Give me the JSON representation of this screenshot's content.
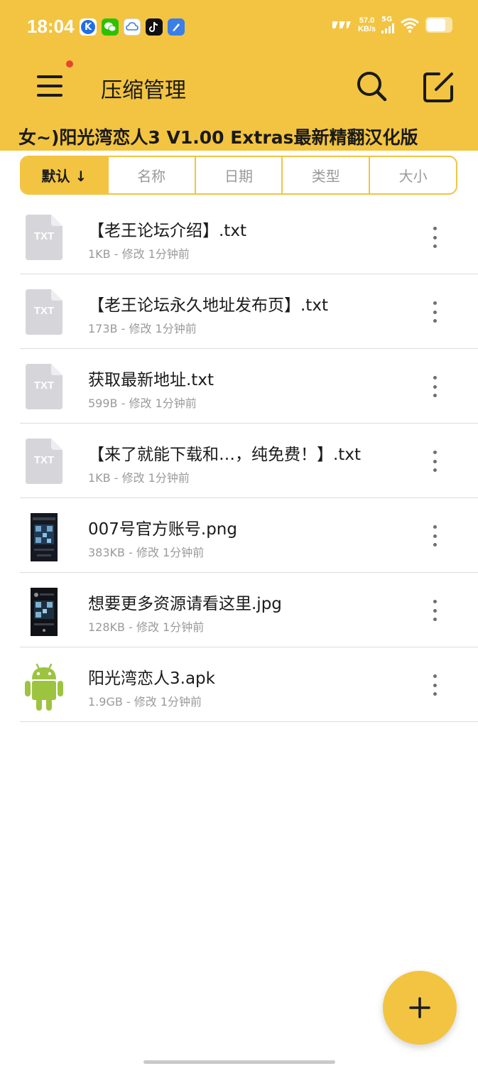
{
  "statusbar": {
    "time": "18:04",
    "network_speed_value": "57.0",
    "network_speed_unit": "KB/s",
    "network_type": "5G",
    "notification_icons": [
      "kuai-icon",
      "wechat-icon",
      "cloud-drive-icon",
      "tiktok-icon",
      "notes-icon"
    ]
  },
  "toolbar": {
    "title": "压缩管理"
  },
  "path": "女~)阳光湾恋人3 V1.00 Extras最新精翻汉化版",
  "sort_tabs": [
    {
      "label": "默认 ↓",
      "active": true
    },
    {
      "label": "名称",
      "active": false
    },
    {
      "label": "日期",
      "active": false
    },
    {
      "label": "类型",
      "active": false
    },
    {
      "label": "大小",
      "active": false
    }
  ],
  "files": [
    {
      "name": "【老王论坛介绍】.txt",
      "meta": "1KB - 修改 1分钟前",
      "type": "txt",
      "icon_label": "TXT"
    },
    {
      "name": "【老王论坛永久地址发布页】.txt",
      "meta": "173B - 修改 1分钟前",
      "type": "txt",
      "icon_label": "TXT"
    },
    {
      "name": "获取最新地址.txt",
      "meta": "599B - 修改 1分钟前",
      "type": "txt",
      "icon_label": "TXT"
    },
    {
      "name": "【来了就能下载和…，纯免费！】.txt",
      "meta": "1KB - 修改 1分钟前",
      "type": "txt",
      "icon_label": "TXT"
    },
    {
      "name": "007号官方账号.png",
      "meta": "383KB - 修改 1分钟前",
      "type": "image"
    },
    {
      "name": "想要更多资源请看这里.jpg",
      "meta": "128KB - 修改 1分钟前",
      "type": "image"
    },
    {
      "name": "阳光湾恋人3.apk",
      "meta": "1.9GB - 修改 1分钟前",
      "type": "apk"
    }
  ],
  "colors": {
    "accent": "#f2c441",
    "txt_icon": "#d6d6da",
    "android_green": "#9cc441"
  }
}
